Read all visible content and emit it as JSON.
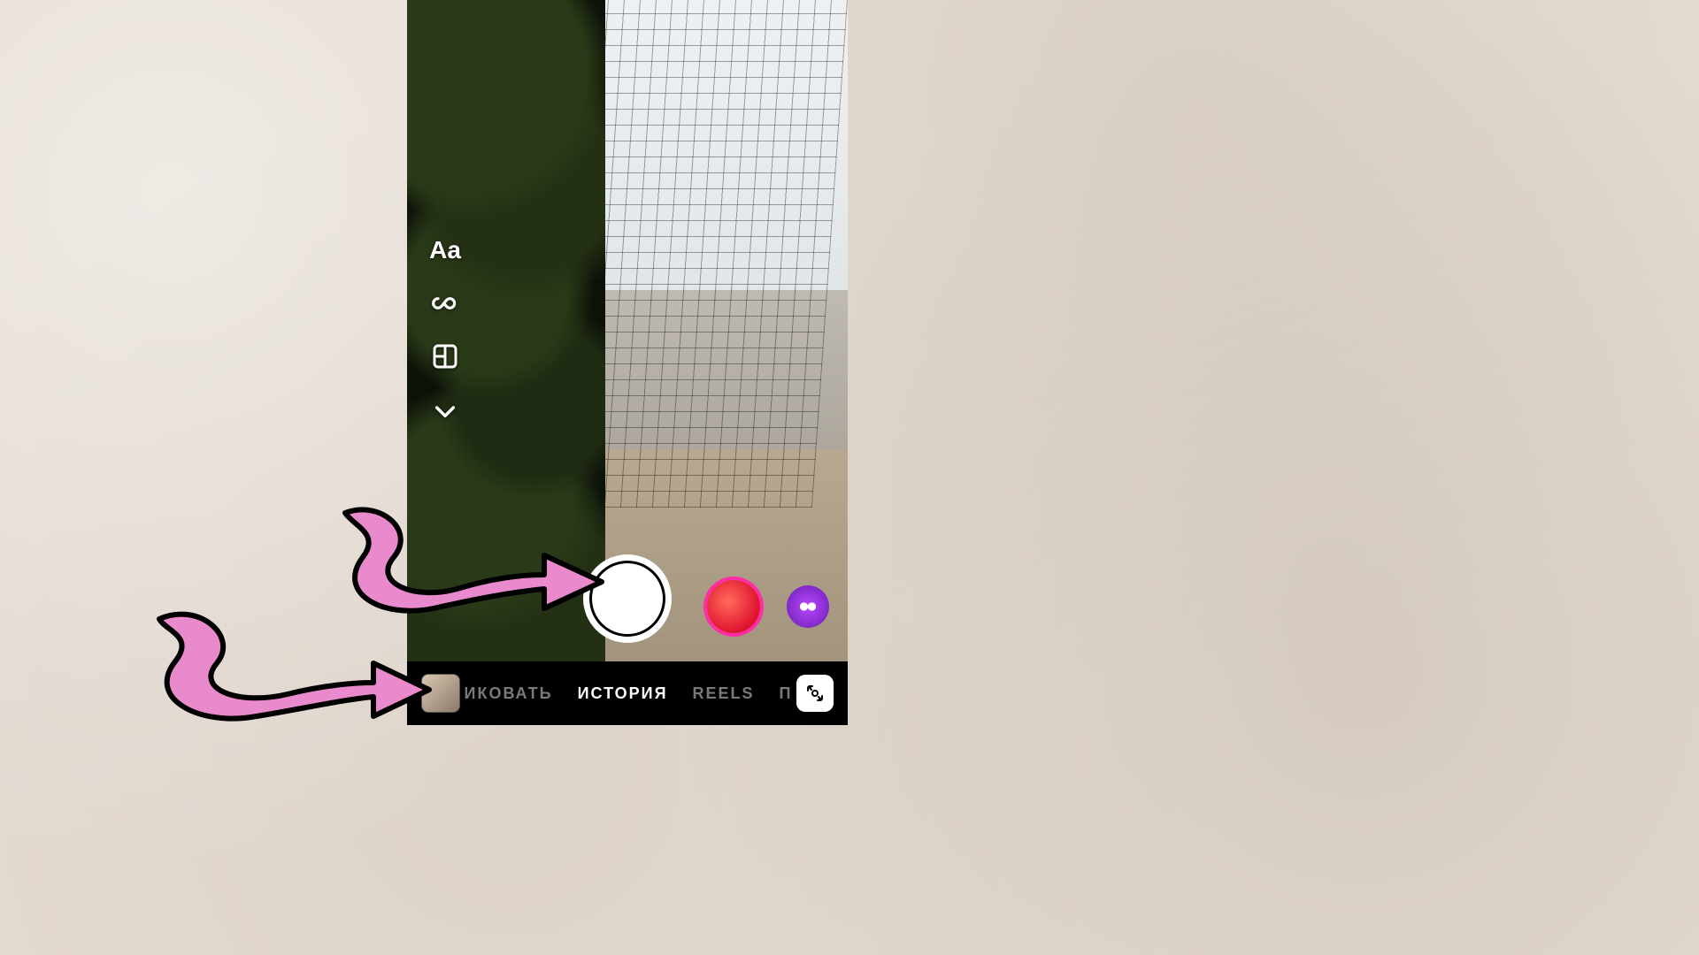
{
  "sideTools": {
    "text_label": "Aa"
  },
  "filters": {
    "shutter_name": "shutter",
    "effect1_name": "red-effect",
    "effect2_name": "purple-face-effect"
  },
  "bottomBar": {
    "thumb_name": "gallery-thumbnail",
    "modes": {
      "prev_partial": "ИКОВАТЬ",
      "active": "ИСТОРИЯ",
      "next": "REELS",
      "next2_partial": "П"
    },
    "flip_name": "flip-camera"
  },
  "annotations": {
    "arrow1_name": "pink-arrow-to-shutter",
    "arrow2_name": "pink-arrow-to-bottom-bar"
  }
}
